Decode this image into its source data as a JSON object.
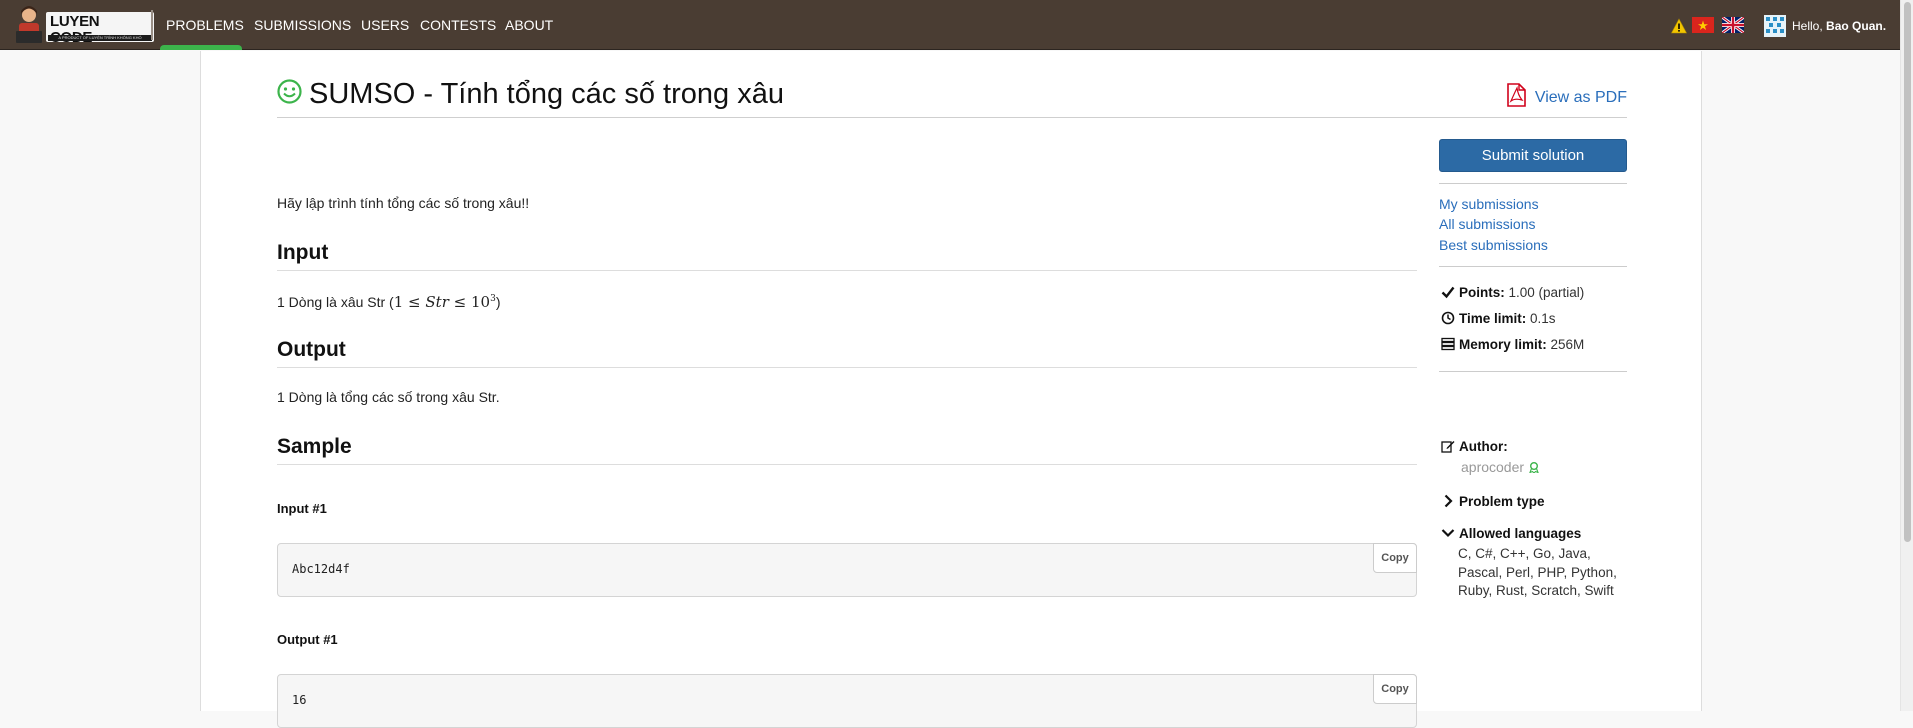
{
  "navbar": {
    "logo_text": "LUYEN CODE",
    "logo_tagline": "A PRODUCT OF LUYỆN TRÌNH KHÔNG KHÓ",
    "items": [
      {
        "label": "PROBLEMS",
        "active": true
      },
      {
        "label": "SUBMISSIONS"
      },
      {
        "label": "USERS"
      },
      {
        "label": "CONTESTS"
      },
      {
        "label": "ABOUT"
      }
    ],
    "greeting": "Hello,",
    "username": "Bao Quan.",
    "active_color": "#3cb44b",
    "bar_color": "#4a3d33"
  },
  "problem": {
    "title": "SUMSO - Tính tổng các số trong xâu",
    "pdf_label": "View as PDF",
    "statement": "Hãy lập trình tính tổng các số trong xâu!!",
    "input_heading": "Input",
    "input_text": "1 Dòng là xâu Str (",
    "input_math": {
      "low": "1",
      "var": "Str",
      "base": "10",
      "exp": "3"
    },
    "input_close": ")",
    "output_heading": "Output",
    "output_text": "1 Dòng là tổng các số trong xâu Str.",
    "sample_heading": "Sample",
    "samples": [
      {
        "label": "Input #1",
        "content": "Abc12d4f",
        "copy": "Copy"
      },
      {
        "label": "Output #1",
        "content": "16",
        "copy": "Copy"
      }
    ]
  },
  "sidebar": {
    "submit_label": "Submit solution",
    "links": [
      "My submissions",
      "All submissions",
      "Best submissions"
    ],
    "points_label": "Points:",
    "points_value": "1.00 (partial)",
    "time_label": "Time limit:",
    "time_value": "0.1s",
    "memory_label": "Memory limit:",
    "memory_value": "256M",
    "author_label": "Author:",
    "author_name": "aprocoder",
    "problem_type_label": "Problem type",
    "languages_label": "Allowed languages",
    "languages": "C, C#, C++, Go, Java, Pascal, Perl, PHP, Python, Ruby, Rust, Scratch, Swift",
    "link_color": "#2a6ebb",
    "button_color": "#2c6aa5"
  }
}
